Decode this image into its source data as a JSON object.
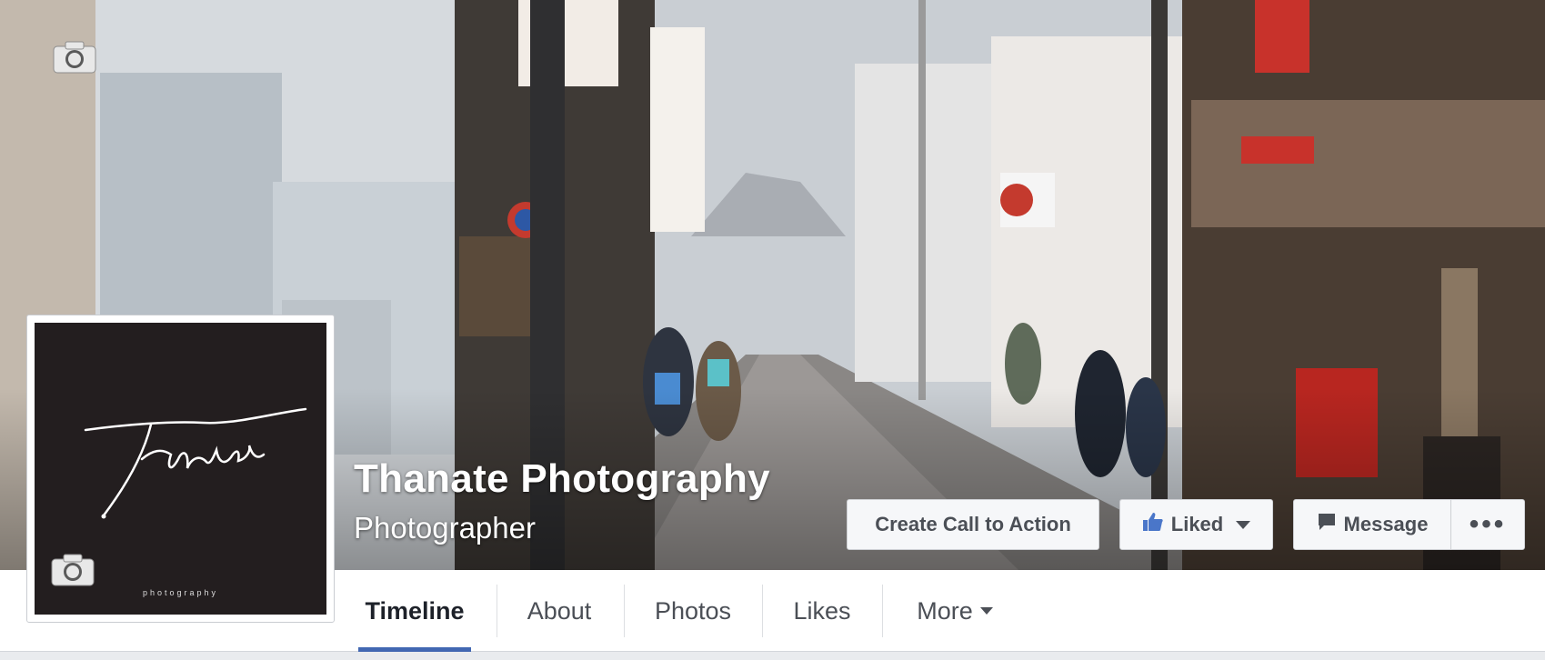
{
  "page": {
    "name": "Thanate Photography",
    "category": "Photographer"
  },
  "profile": {
    "logo_text": "Thanate",
    "logo_subtext": "photography"
  },
  "actions": {
    "create_cta": "Create Call to Action",
    "liked": "Liked",
    "message": "Message",
    "more": "•••"
  },
  "tabs": [
    {
      "label": "Timeline",
      "active": true
    },
    {
      "label": "About"
    },
    {
      "label": "Photos"
    },
    {
      "label": "Likes"
    },
    {
      "label": "More"
    }
  ],
  "icons": {
    "cover_camera": "camera-icon",
    "profile_camera": "camera-icon",
    "like": "thumbs-up-icon",
    "message": "speech-bubble-icon",
    "dropdown": "caret-down-icon"
  },
  "colors": {
    "accent": "#4267b2",
    "like_blue": "#4a76c9",
    "logo_bg": "#231e1f"
  }
}
